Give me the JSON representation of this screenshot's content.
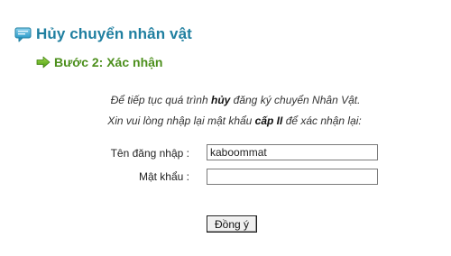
{
  "header": {
    "title": "Hủy chuyển nhân vật",
    "icon": "chat-bubble-icon",
    "color": "#1f7fa0"
  },
  "step": {
    "title": "Bước 2: Xác nhận",
    "icon": "green-arrow-icon",
    "color": "#4c8f1c"
  },
  "instructions": {
    "line1_before": "Để tiếp tục quá trình ",
    "line1_bold": "hủy",
    "line1_after": " đăng ký chuyển Nhân Vật.",
    "line2_before": "Xin vui lòng nhập lại mật khẩu ",
    "line2_bold": "cấp II",
    "line2_after": " để xác nhận lại:"
  },
  "form": {
    "username_label": "Tên đăng nhập :",
    "username_value": "kaboommat",
    "password_label": "Mật khẩu :",
    "password_value": "",
    "submit_label": "Đồng ý"
  }
}
